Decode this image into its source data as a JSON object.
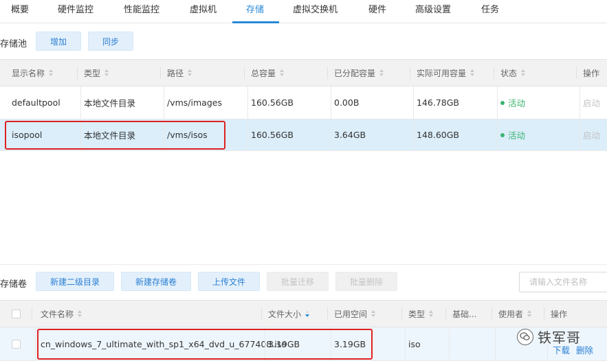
{
  "tabs": [
    {
      "label": "概要"
    },
    {
      "label": "硬件监控"
    },
    {
      "label": "性能监控"
    },
    {
      "label": "虚拟机"
    },
    {
      "label": "存储",
      "active": true
    },
    {
      "label": "虚拟交换机"
    },
    {
      "label": "硬件"
    },
    {
      "label": "高级设置"
    },
    {
      "label": "任务"
    }
  ],
  "pool_section": {
    "title": "存储池",
    "add_label": "增加",
    "sync_label": "同步",
    "columns": [
      "显示名称",
      "类型",
      "路径",
      "总容量",
      "已分配容量",
      "实际可用容量",
      "状态",
      "操作"
    ],
    "rows": [
      {
        "name": "defaultpool",
        "type": "本地文件目录",
        "path": "/vms/images",
        "total": "160.56GB",
        "allocated": "0.00B",
        "available": "146.78GB",
        "status": "活动",
        "op": "启动"
      },
      {
        "name": "isopool",
        "type": "本地文件目录",
        "path": "/vms/isos",
        "total": "160.56GB",
        "allocated": "3.64GB",
        "available": "148.60GB",
        "status": "活动",
        "op": "启动",
        "selected": true
      }
    ]
  },
  "volume_section": {
    "title": "存储卷",
    "buttons": {
      "new_subdir": "新建二级目录",
      "new_volume": "新建存储卷",
      "upload": "上传文件",
      "batch_migrate": "批量迁移",
      "batch_delete": "批量删除"
    },
    "search_placeholder": "请输入文件名称",
    "columns": [
      "文件名称",
      "文件大小",
      "已用空间",
      "类型",
      "基础...",
      "使用者",
      "操作"
    ],
    "rows": [
      {
        "filename": "cn_windows_7_ultimate_with_sp1_x64_dvd_u_677408.iso",
        "size": "3.19GB",
        "used": "3.19GB",
        "type": "iso",
        "base": "",
        "user": "",
        "op_download": "下载",
        "op_delete": "删除"
      }
    ]
  },
  "watermark": "铁军哥",
  "colors": {
    "accent": "#2a8ad6",
    "active_status": "#3cb371",
    "highlight_box": "#e02020",
    "selected_row": "#dbeefa"
  }
}
